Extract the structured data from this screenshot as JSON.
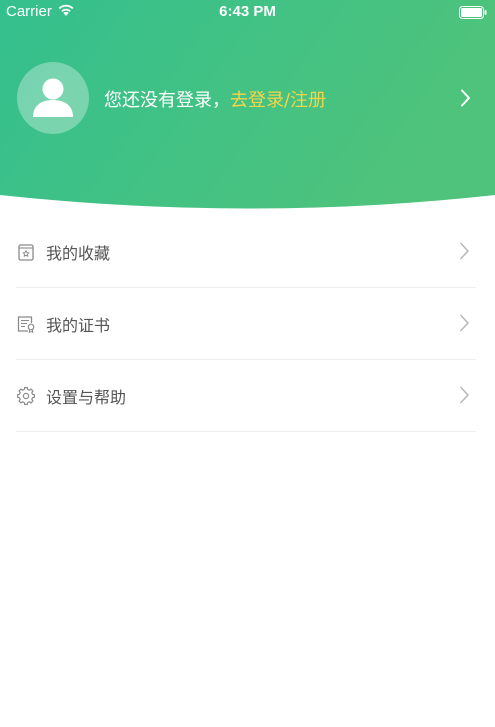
{
  "status_bar": {
    "carrier": "Carrier",
    "time": "6:43 PM"
  },
  "profile": {
    "prompt": "您还没有登录，",
    "login_link": "去登录/注册"
  },
  "menu": {
    "items": [
      {
        "label": "我的收藏",
        "icon": "favorites-icon"
      },
      {
        "label": "我的证书",
        "icon": "certificate-icon"
      },
      {
        "label": "设置与帮助",
        "icon": "settings-gear-icon"
      }
    ]
  },
  "colors": {
    "header_gradient_start": "#34c08e",
    "header_gradient_end": "#52c57a",
    "login_link": "#f3d54a",
    "menu_text": "#555555",
    "divider": "#eeeeee"
  }
}
